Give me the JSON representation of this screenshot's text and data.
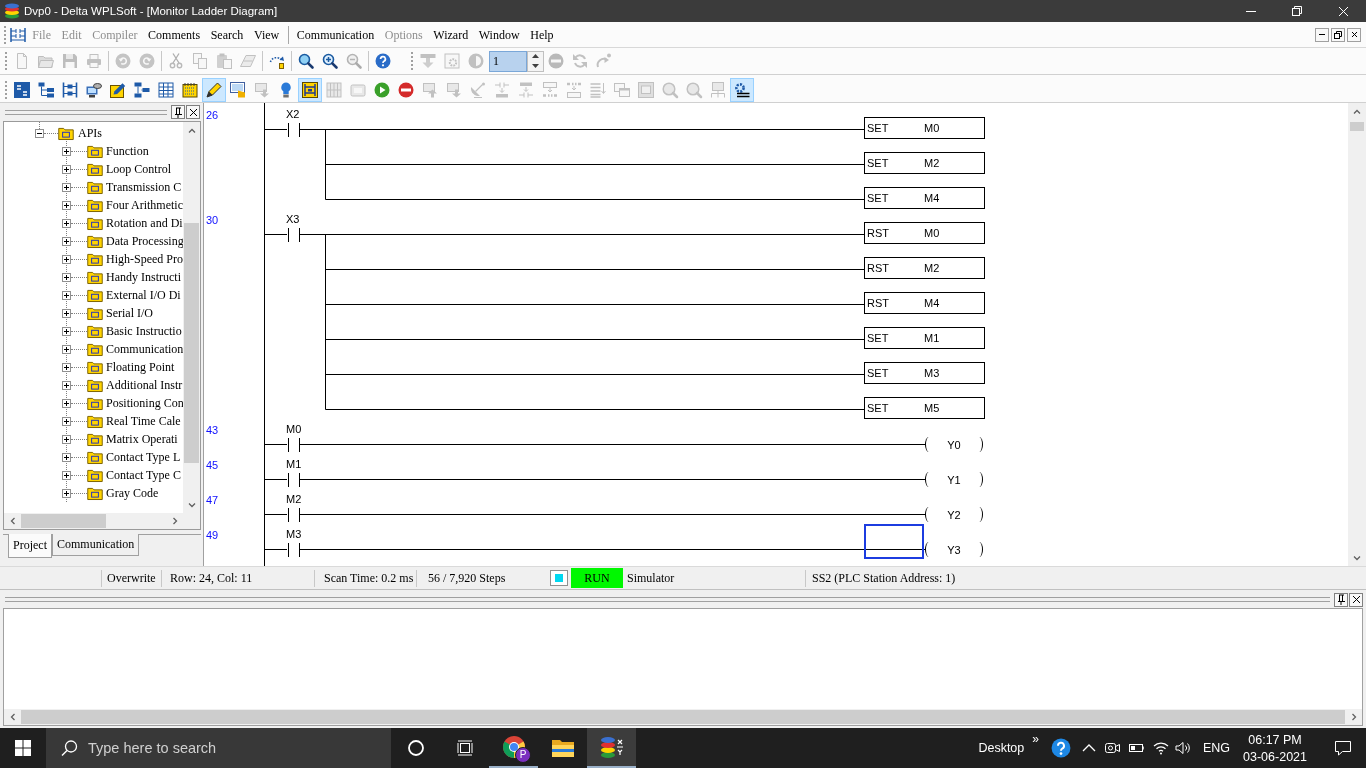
{
  "title_bar": {
    "title": "Dvp0 - Delta WPLSoft - [Monitor Ladder Diagram]"
  },
  "menu_groups": [
    [
      {
        "label": "File",
        "disabled": true
      },
      {
        "label": "Edit",
        "disabled": true
      },
      {
        "label": "Compiler",
        "disabled": true
      },
      {
        "label": "Comments",
        "disabled": false
      },
      {
        "label": "Search",
        "disabled": false
      },
      {
        "label": "View",
        "disabled": false
      }
    ],
    [
      {
        "label": "Communication",
        "disabled": false
      },
      {
        "label": "Options",
        "disabled": true
      },
      {
        "label": "Wizard",
        "disabled": false
      },
      {
        "label": "Window",
        "disabled": false
      },
      {
        "label": "Help",
        "disabled": false
      }
    ]
  ],
  "toolbar_rows": [
    [
      {
        "groups": [
          [
            {
              "kind": "page",
              "disabled": true
            },
            {
              "kind": "folder",
              "disabled": true
            },
            {
              "kind": "disk",
              "disabled": true
            },
            {
              "kind": "printer",
              "disabled": true
            }
          ],
          [
            {
              "kind": "undo",
              "disabled": true
            },
            {
              "kind": "redo",
              "disabled": true
            }
          ],
          [
            {
              "kind": "cut",
              "disabled": true
            },
            {
              "kind": "copy",
              "disabled": true
            },
            {
              "kind": "paste",
              "disabled": true
            },
            {
              "kind": "eraser",
              "disabled": true
            }
          ],
          [
            {
              "kind": "jump",
              "disabled": false
            }
          ],
          [
            {
              "kind": "find",
              "disabled": false
            },
            {
              "kind": "zoom_in",
              "disabled": false
            },
            {
              "kind": "zoom_out",
              "disabled": true
            }
          ],
          [
            {
              "kind": "help",
              "disabled": false
            }
          ]
        ]
      },
      {
        "groups": [
          [
            {
              "kind": "write_bar",
              "disabled": true
            },
            {
              "kind": "gear_page",
              "disabled": true
            },
            {
              "kind": "half_circle",
              "disabled": true
            },
            {
              "kind": "spin_field",
              "value": "1"
            },
            {
              "kind": "stop",
              "disabled": true
            },
            {
              "kind": "refresh",
              "disabled": true
            },
            {
              "kind": "step_arrow",
              "disabled": true
            }
          ]
        ]
      }
    ],
    [
      {
        "groups": [
          [
            {
              "kind": "ld_tile",
              "disabled": false,
              "pressed": false
            },
            {
              "kind": "tree",
              "disabled": false,
              "pressed": false
            },
            {
              "kind": "ladder_block",
              "disabled": false,
              "pressed": false
            },
            {
              "kind": "computer",
              "disabled": false,
              "pressed": false
            },
            {
              "kind": "pencil",
              "disabled": false,
              "pressed": false
            },
            {
              "kind": "blocks",
              "disabled": false,
              "pressed": false
            },
            {
              "kind": "table",
              "disabled": false,
              "pressed": false
            },
            {
              "kind": "notepad",
              "disabled": false,
              "pressed": false
            },
            {
              "kind": "pen",
              "disabled": false,
              "pressed": true
            },
            {
              "kind": "screen_hand",
              "disabled": false,
              "pressed": false
            },
            {
              "kind": "screen_down",
              "disabled": true,
              "pressed": false
            },
            {
              "kind": "bulb",
              "disabled": false,
              "pressed": false
            },
            {
              "kind": "ladder_tile",
              "disabled": false,
              "pressed": true
            },
            {
              "kind": "panel",
              "disabled": true,
              "pressed": false
            },
            {
              "kind": "device",
              "disabled": true,
              "pressed": false
            },
            {
              "kind": "go",
              "disabled": false,
              "pressed": false
            },
            {
              "kind": "stop",
              "disabled": false,
              "pressed": false
            },
            {
              "kind": "screen_up",
              "disabled": true,
              "pressed": false
            },
            {
              "kind": "screen_down",
              "disabled": true,
              "pressed": false
            },
            {
              "kind": "dish",
              "disabled": true,
              "pressed": false
            },
            {
              "kind": "code_down",
              "disabled": true,
              "pressed": false
            },
            {
              "kind": "code_up",
              "disabled": true,
              "pressed": false
            },
            {
              "kind": "box_bits",
              "disabled": true,
              "pressed": false
            },
            {
              "kind": "bits_box",
              "disabled": true,
              "pressed": false
            },
            {
              "kind": "lines_arrow",
              "disabled": true,
              "pressed": false
            },
            {
              "kind": "windows",
              "disabled": true,
              "pressed": false
            },
            {
              "kind": "frame",
              "disabled": true,
              "pressed": false
            },
            {
              "kind": "magnifier",
              "disabled": true,
              "pressed": false
            },
            {
              "kind": "magnifier",
              "disabled": true,
              "pressed": false
            },
            {
              "kind": "network",
              "disabled": true,
              "pressed": false
            },
            {
              "kind": "gear_lines",
              "disabled": false,
              "pressed": true
            }
          ]
        ]
      }
    ]
  ],
  "project_panel": {
    "tree": [
      {
        "label": "APIs",
        "expanded": true,
        "children": [
          {
            "label": "Function",
            "expanded": false
          },
          {
            "label": "Loop Control",
            "expanded": false
          },
          {
            "label": "Transmission C",
            "expanded": false
          },
          {
            "label": "Four Arithmetic",
            "expanded": false
          },
          {
            "label": "Rotation and Di",
            "expanded": false
          },
          {
            "label": "Data Processing",
            "expanded": false
          },
          {
            "label": "High-Speed Pro",
            "expanded": false
          },
          {
            "label": "Handy Instructi",
            "expanded": false
          },
          {
            "label": "External I/O Di",
            "expanded": false
          },
          {
            "label": "Serial I/O",
            "expanded": false
          },
          {
            "label": "Basic Instructio",
            "expanded": false
          },
          {
            "label": "Communication",
            "expanded": false
          },
          {
            "label": "Floating Point",
            "expanded": false
          },
          {
            "label": "Additional Instr",
            "expanded": false
          },
          {
            "label": "Positioning Con",
            "expanded": false
          },
          {
            "label": "Real Time Cale",
            "expanded": false
          },
          {
            "label": "Matrix Operati",
            "expanded": false
          },
          {
            "label": "Contact Type L",
            "expanded": false
          },
          {
            "label": "Contact Type C",
            "expanded": false
          },
          {
            "label": "Gray Code",
            "expanded": false
          }
        ]
      }
    ],
    "tabs": [
      {
        "label": "Project",
        "selected": true
      },
      {
        "label": "Communication",
        "selected": false
      }
    ]
  },
  "ladder": {
    "rungs": [
      {
        "step": "26",
        "selected": false,
        "contacts": [
          {
            "label": "X2"
          }
        ],
        "outputs": [
          {
            "kind": "instruction",
            "op": "SET",
            "operand": "M0"
          },
          {
            "kind": "instruction",
            "op": "SET",
            "operand": "M2"
          },
          {
            "kind": "instruction",
            "op": "SET",
            "operand": "M4"
          }
        ]
      },
      {
        "step": "30",
        "selected": false,
        "contacts": [
          {
            "label": "X3"
          }
        ],
        "outputs": [
          {
            "kind": "instruction",
            "op": "RST",
            "operand": "M0"
          },
          {
            "kind": "instruction",
            "op": "RST",
            "operand": "M2"
          },
          {
            "kind": "instruction",
            "op": "RST",
            "operand": "M4"
          },
          {
            "kind": "instruction",
            "op": "SET",
            "operand": "M1"
          },
          {
            "kind": "instruction",
            "op": "SET",
            "operand": "M3"
          },
          {
            "kind": "instruction",
            "op": "SET",
            "operand": "M5"
          }
        ]
      },
      {
        "step": "43",
        "selected": false,
        "contacts": [
          {
            "label": "M0"
          }
        ],
        "outputs": [
          {
            "kind": "coil",
            "operand": "Y0"
          }
        ]
      },
      {
        "step": "45",
        "selected": false,
        "contacts": [
          {
            "label": "M1"
          }
        ],
        "outputs": [
          {
            "kind": "coil",
            "operand": "Y1"
          }
        ]
      },
      {
        "step": "47",
        "selected": false,
        "contacts": [
          {
            "label": "M2"
          }
        ],
        "outputs": [
          {
            "kind": "coil",
            "operand": "Y2"
          }
        ]
      },
      {
        "step": "49",
        "selected": true,
        "contacts": [
          {
            "label": "M3"
          }
        ],
        "outputs": [
          {
            "kind": "coil",
            "operand": "Y3"
          }
        ]
      }
    ]
  },
  "status_bar": {
    "mode": "Overwrite",
    "cursor_position": "Row: 24, Col: 11",
    "scan_time": "Scan Time: 0.2 ms",
    "steps": "56 / 7,920 Steps",
    "run_state": {
      "label": "RUN",
      "running": true
    },
    "target": "Simulator",
    "station": "SS2 (PLC Station Address: 1)"
  },
  "taskbar": {
    "search_placeholder": "Type here to search",
    "apps": [
      {
        "kind": "browser",
        "badge": "P",
        "running": true,
        "active": false
      },
      {
        "kind": "explorer",
        "running": false,
        "active": false
      },
      {
        "kind": "ladder_app",
        "running": true,
        "active": true
      }
    ],
    "desktop_label": "Desktop",
    "more": "»",
    "language": "ENG",
    "time": "06:17 PM",
    "date": "03-06-2021"
  }
}
